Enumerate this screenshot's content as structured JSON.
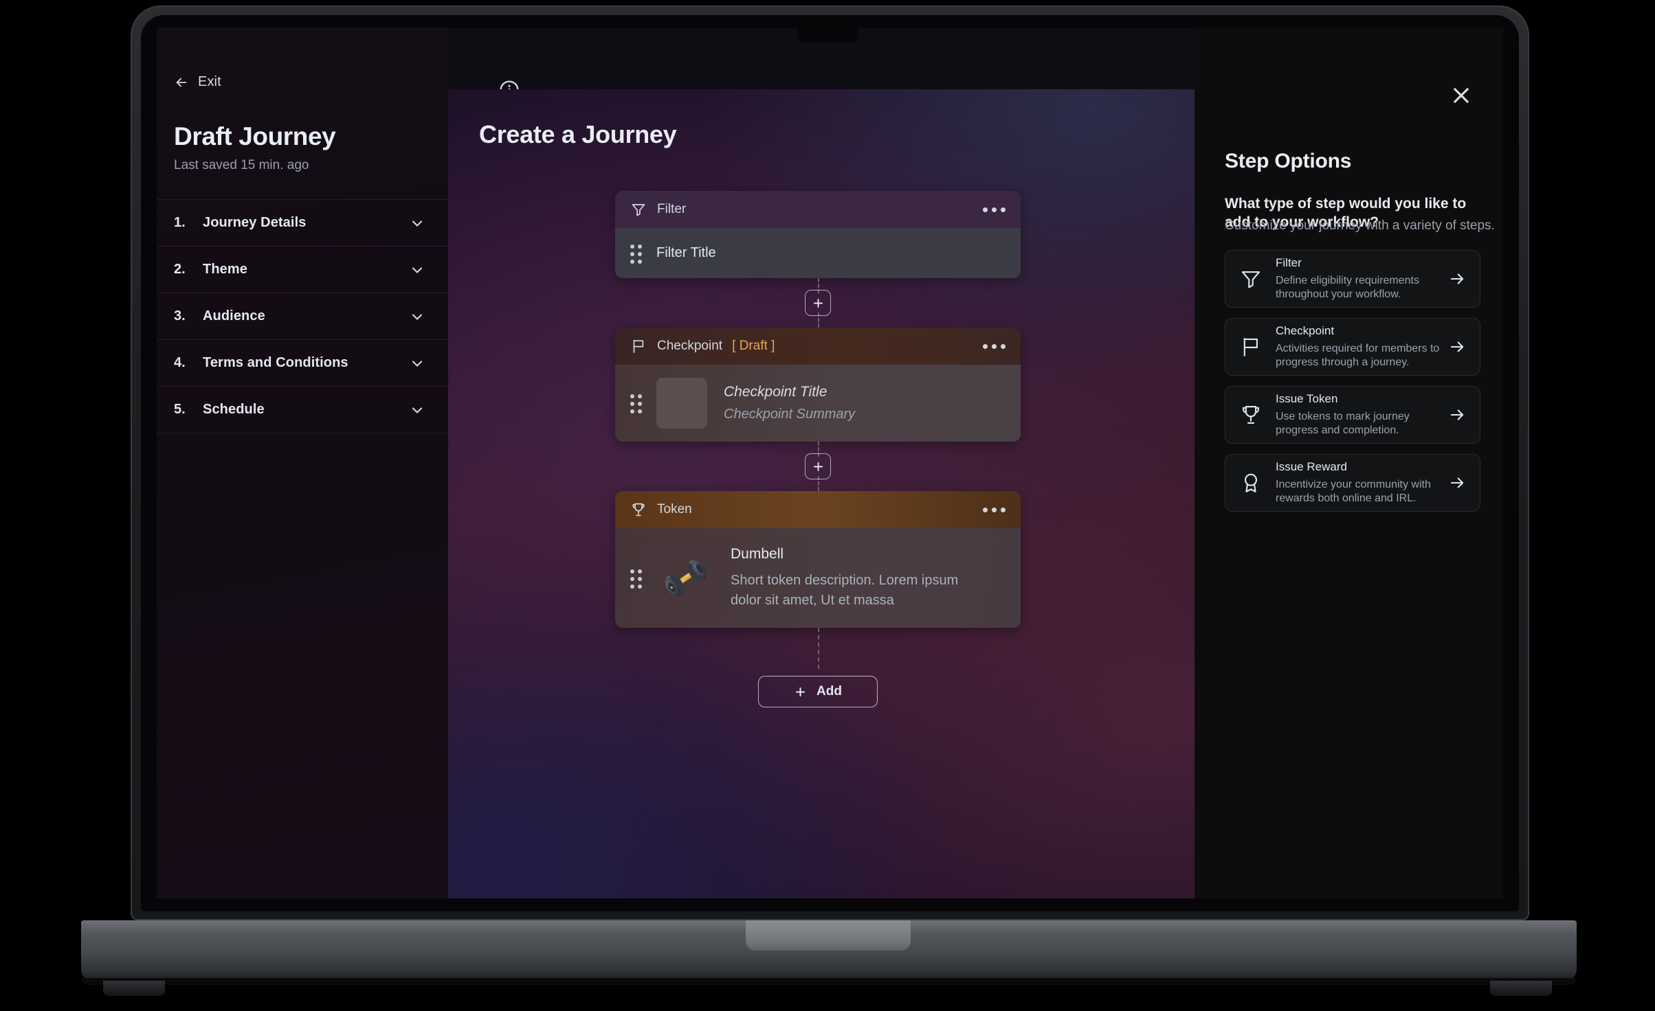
{
  "sidebar": {
    "exit_label": "Exit",
    "exit_icon": "arrow-left-icon",
    "title": "Draft Journey",
    "subtitle": "Last saved 15 min. ago",
    "items": [
      {
        "num": "1.",
        "label": "Journey Details",
        "icon": "chevron-down-icon"
      },
      {
        "num": "2.",
        "label": "Theme",
        "icon": "chevron-down-icon"
      },
      {
        "num": "3.",
        "label": "Audience",
        "icon": "chevron-down-icon"
      },
      {
        "num": "4.",
        "label": "Terms and Conditions",
        "icon": "chevron-down-icon"
      },
      {
        "num": "5.",
        "label": "Schedule",
        "icon": "chevron-down-icon"
      }
    ]
  },
  "canvas": {
    "info_icon": "info-circle-icon",
    "title": "Create a Journey",
    "add_button": {
      "label": "Add",
      "icon": "plus-icon"
    },
    "connector_icon": "plus-icon",
    "menu_icon": "ellipsis-icon",
    "drag_icon": "drag-handle-icon",
    "steps": [
      {
        "type": "filter",
        "head_label": "Filter",
        "head_icon": "funnel-icon",
        "head_badge": "",
        "title": "Filter Title",
        "summary": ""
      },
      {
        "type": "checkpoint",
        "head_label": "Checkpoint",
        "head_icon": "flag-icon",
        "head_badge": "[ Draft ]",
        "title": "Checkpoint Title",
        "summary": "Checkpoint Summary"
      },
      {
        "type": "token",
        "head_label": "Token",
        "head_icon": "trophy-icon",
        "head_badge": "",
        "title": "Dumbell",
        "summary": "Short token description. Lorem ipsum dolor sit amet, Ut et massa",
        "thumb_icon": "dumbbell-image"
      }
    ]
  },
  "panel": {
    "close_icon": "close-icon",
    "title": "Step Options",
    "question": "What type of step would you like to add to your workflow?",
    "subtitle": "Customize your journey with a variety of steps.",
    "options": [
      {
        "name": "Filter",
        "desc": "Define eligibility requirements throughout your workflow.",
        "icon": "funnel-icon",
        "arrow": "arrow-right-icon"
      },
      {
        "name": "Checkpoint",
        "desc": "Activities required for members to progress through a journey.",
        "icon": "flag-icon",
        "arrow": "arrow-right-icon"
      },
      {
        "name": "Issue Token",
        "desc": "Use tokens to mark journey progress and completion.",
        "icon": "trophy-icon",
        "arrow": "arrow-right-icon"
      },
      {
        "name": "Issue Reward",
        "desc": "Incentivize your community with rewards both online and IRL.",
        "icon": "award-icon",
        "arrow": "arrow-right-icon"
      }
    ]
  },
  "colors": {
    "draft_badge": "#eba547",
    "filter_header": "#3b2742",
    "checkpoint_header": "#46291f",
    "token_header": "#6b4320",
    "panel_bg": "#0d0d0e",
    "sidebar_bg": "#130c14"
  }
}
